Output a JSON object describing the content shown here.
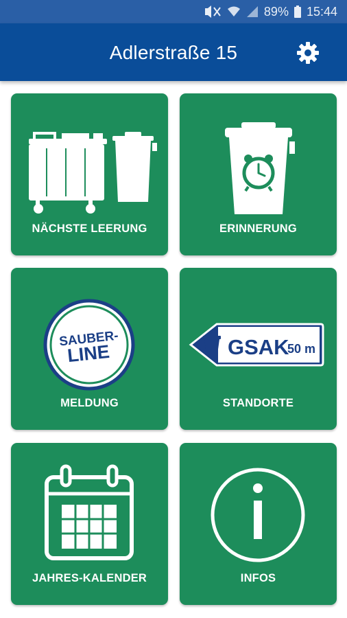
{
  "status_bar": {
    "battery_percent": "89%",
    "time": "15:44"
  },
  "header": {
    "title": "Adlerstraße 15"
  },
  "tiles": [
    {
      "label": "NÄCHSTE LEERUNG"
    },
    {
      "label": "ERINNERUNG"
    },
    {
      "label": "MELDUNG",
      "badge_line1": "SAUBER-",
      "badge_line2": "LINE"
    },
    {
      "label": "STANDORTE",
      "sign_text": "GSAK",
      "sign_distance": "50 m"
    },
    {
      "label": "JAHRES-KALENDER"
    },
    {
      "label": "INFOS"
    }
  ],
  "colors": {
    "tile_green": "#1d8d5b",
    "app_bar_blue": "#0a4d99",
    "status_blue": "#2a5fa6",
    "badge_navy": "#1b3f86"
  }
}
